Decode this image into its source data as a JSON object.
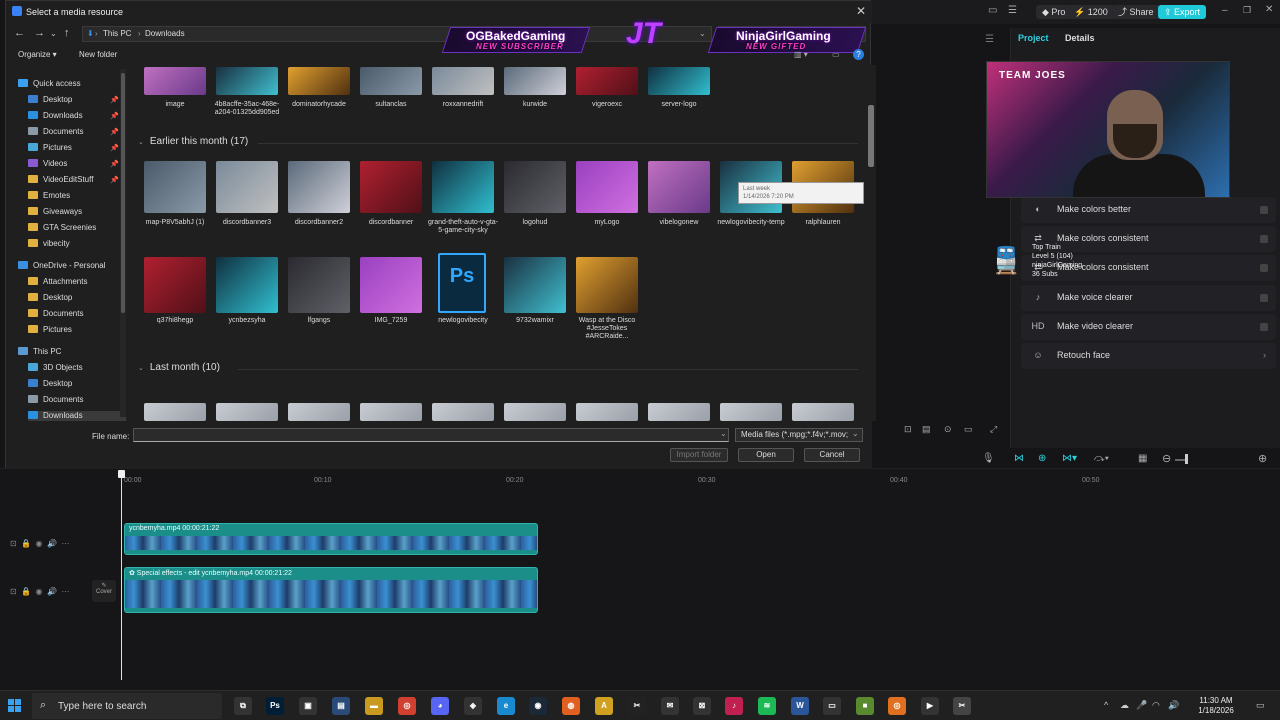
{
  "dialog": {
    "title": "Select a media resource",
    "breadcrumb": [
      "This PC",
      "Downloads"
    ],
    "toolbar": {
      "organize": "Organize ▾",
      "new_folder": "New folder"
    },
    "nav_items": [
      {
        "label": "Quick access",
        "color": "#3aa0f0",
        "pinned": false,
        "indent": 0
      },
      {
        "label": "Desktop",
        "color": "#3a7fd0",
        "pinned": true,
        "indent": 1
      },
      {
        "label": "Downloads",
        "color": "#2a90e0",
        "pinned": true,
        "indent": 1
      },
      {
        "label": "Documents",
        "color": "#8a9aa8",
        "pinned": true,
        "indent": 1
      },
      {
        "label": "Pictures",
        "color": "#4aa8d8",
        "pinned": true,
        "indent": 1
      },
      {
        "label": "Videos",
        "color": "#8a5ad0",
        "pinned": true,
        "indent": 1
      },
      {
        "label": "VideoEditStuff",
        "color": "#e0b040",
        "pinned": true,
        "indent": 1
      },
      {
        "label": "Emotes",
        "color": "#e0b040",
        "pinned": false,
        "indent": 1
      },
      {
        "label": "Giveaways",
        "color": "#e0b040",
        "pinned": false,
        "indent": 1
      },
      {
        "label": "GTA Screenies",
        "color": "#e0b040",
        "pinned": false,
        "indent": 1
      },
      {
        "label": "vibecity",
        "color": "#e0b040",
        "pinned": false,
        "indent": 1
      },
      {
        "label": "OneDrive - Personal",
        "color": "#3a90e0",
        "pinned": false,
        "indent": 0
      },
      {
        "label": "Attachments",
        "color": "#e0b040",
        "pinned": false,
        "indent": 1
      },
      {
        "label": "Desktop",
        "color": "#e0b040",
        "pinned": false,
        "indent": 1
      },
      {
        "label": "Documents",
        "color": "#e0b040",
        "pinned": false,
        "indent": 1
      },
      {
        "label": "Pictures",
        "color": "#e0b040",
        "pinned": false,
        "indent": 1
      },
      {
        "label": "This PC",
        "color": "#5a9ad0",
        "pinned": false,
        "indent": 0
      },
      {
        "label": "3D Objects",
        "color": "#4aa8d8",
        "pinned": false,
        "indent": 1
      },
      {
        "label": "Desktop",
        "color": "#3a7fd0",
        "pinned": false,
        "indent": 1
      },
      {
        "label": "Documents",
        "color": "#8a9aa8",
        "pinned": false,
        "indent": 1
      },
      {
        "label": "Downloads",
        "color": "#2a90e0",
        "pinned": false,
        "indent": 1
      }
    ],
    "top_row_files": [
      "image",
      "4b8acffe-35ac-468e-a204-01325dd905ed",
      "dominatorhycade",
      "sultanclas",
      "roxxannedrift",
      "kurwide",
      "vigeroexc",
      "server-logo"
    ],
    "group_earlier": "Earlier this month (17)",
    "group_last_month": "Last month (10)",
    "earlier_row1": [
      "map-P8V5abhJ (1)",
      "discordbanner3",
      "discordbanner2",
      "discordbanner",
      "grand-theft-auto-v-gta-5-game-city-sky",
      "logohud",
      "myLogo",
      "vibelogonew",
      "newlogovibecity-temp",
      "ralphlauren"
    ],
    "earlier_row2": [
      "q37hi8hegp",
      "ycnbezsyha",
      "lfgangs",
      "IMG_7259",
      "newlogovibecity",
      "9732wamixr",
      "Wasp at the Disco #JesseTokes #ARCRaide..."
    ],
    "tooltip": "Last week\n1/14/2026 7:20 PM",
    "file_name_label": "File name:",
    "file_name_value": "",
    "filter": "Media files (*.mpg;*.f4v;*.mov;",
    "buttons": {
      "import_folder": "Import folder",
      "open": "Open",
      "cancel": "Cancel"
    }
  },
  "overlay": {
    "left_name": "OGBakedGaming",
    "left_sub": "NEW SUBSCRIBER",
    "right_name": "NinjaGirlGaming",
    "right_sub": "NEW GIFTED",
    "logo": "JT"
  },
  "editor": {
    "top_buttons": {
      "pro": "Pro",
      "credits": "1200",
      "share": "Share",
      "export": "Export"
    },
    "tabs": {
      "project": "Project",
      "details": "Details"
    },
    "webcam_text": "TEAM JOES",
    "menu_items": [
      {
        "icon": "◐",
        "label": "Make colors better"
      },
      {
        "icon": "⇄",
        "label": "Make colors consistent"
      },
      {
        "icon": "⇄",
        "label": "Make colors consistent"
      },
      {
        "icon": "♪",
        "label": "Make voice clearer"
      },
      {
        "icon": "HD",
        "label": "Make video clearer"
      },
      {
        "icon": "☺",
        "label": "Retouch face"
      }
    ],
    "train_overlay": [
      "Top Train",
      "Level 5 (104)",
      "ninjaGirlGaming",
      "36 Subs"
    ],
    "ruler": [
      "00:00",
      "00:10",
      "00:20",
      "00:30",
      "00:40",
      "00:50"
    ],
    "clip1_label": "ycnbemyha.mp4   00:00:21:22",
    "clip2_label": "✿ Special effects - edit  ycnbemyha.mp4   00:00:21:22",
    "cover_label": "Cover"
  },
  "taskbar": {
    "search_placeholder": "Type here to search",
    "time": "11:30 AM",
    "date": "1/18/2026"
  }
}
